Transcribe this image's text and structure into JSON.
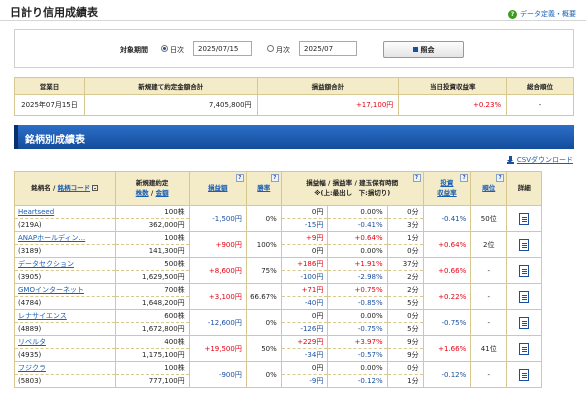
{
  "header": {
    "title": "日計り信用成績表",
    "help_link": "データ定義・概要"
  },
  "filter": {
    "label": "対象期間",
    "daily_label": "日次",
    "daily_value": "2025/07/15",
    "monthly_label": "月次",
    "monthly_value": "2025/07",
    "search_button": "照会"
  },
  "summary": {
    "headers": [
      "営業日",
      "新規建て約定金額合計",
      "損益額合計",
      "当日投資収益率",
      "総合順位"
    ],
    "values": [
      "2025年07月15日",
      "7,405,800円",
      "+17,100円",
      "+0.23%",
      "-"
    ]
  },
  "section": {
    "title": "銘柄別成績表",
    "csv_link": "CSVダウンロード"
  },
  "table": {
    "headers": {
      "name": "銘柄名 /",
      "code": "銘柄コード",
      "contract_line1": "新規建約定",
      "contract_count": "株数",
      "contract_sep": " / ",
      "contract_amount": "金額",
      "profit": "損益額",
      "win_rate": "勝率",
      "range_line1": "損益幅 / 損益率 / 建玉保有時間",
      "range_line2": "※(上:最出し　下:損切り)",
      "yield_line1": "投資",
      "yield_line2": "収益率",
      "rank": "順位",
      "detail": "詳細",
      "q": "?"
    },
    "rows": [
      {
        "name": "Heartseed",
        "code": "(219A)",
        "shares": "100株",
        "amount": "362,000円",
        "profit": "-1,500円",
        "win": "0%",
        "up_amt": "0円",
        "up_pct": "0.00%",
        "up_time": "0分",
        "dn_amt": "-15円",
        "dn_pct": "-0.41%",
        "dn_time": "3分",
        "yield": "-0.41%",
        "rank": "50位"
      },
      {
        "name": "ANAPホールディン...",
        "code": "(3189)",
        "shares": "100株",
        "amount": "141,300円",
        "profit": "+900円",
        "win": "100%",
        "up_amt": "+9円",
        "up_pct": "+0.64%",
        "up_time": "1分",
        "dn_amt": "0円",
        "dn_pct": "0.00%",
        "dn_time": "0分",
        "yield": "+0.64%",
        "rank": "2位"
      },
      {
        "name": "データセクション",
        "code": "(3905)",
        "shares": "500株",
        "amount": "1,629,500円",
        "profit": "+8,600円",
        "win": "75%",
        "up_amt": "+186円",
        "up_pct": "+1.91%",
        "up_time": "37分",
        "dn_amt": "-100円",
        "dn_pct": "-2.98%",
        "dn_time": "2分",
        "yield": "+0.66%",
        "rank": "-"
      },
      {
        "name": "GMOインターネット",
        "code": "(4784)",
        "shares": "700株",
        "amount": "1,648,200円",
        "profit": "+3,100円",
        "win": "66.67%",
        "up_amt": "+71円",
        "up_pct": "+0.75%",
        "up_time": "2分",
        "dn_amt": "-40円",
        "dn_pct": "-0.85%",
        "dn_time": "5分",
        "yield": "+0.22%",
        "rank": "-"
      },
      {
        "name": "レナサイエンス",
        "code": "(4889)",
        "shares": "600株",
        "amount": "1,672,800円",
        "profit": "-12,600円",
        "win": "0%",
        "up_amt": "0円",
        "up_pct": "0.00%",
        "up_time": "0分",
        "dn_amt": "-126円",
        "dn_pct": "-0.75%",
        "dn_time": "5分",
        "yield": "-0.75%",
        "rank": "-"
      },
      {
        "name": "リベルタ",
        "code": "(4935)",
        "shares": "400株",
        "amount": "1,175,100円",
        "profit": "+19,500円",
        "win": "50%",
        "up_amt": "+229円",
        "up_pct": "+3.97%",
        "up_time": "9分",
        "dn_amt": "-34円",
        "dn_pct": "-0.57%",
        "dn_time": "9分",
        "yield": "+1.66%",
        "rank": "41位"
      },
      {
        "name": "フジクラ",
        "code": "(5803)",
        "shares": "100株",
        "amount": "777,100円",
        "profit": "-900円",
        "win": "0%",
        "up_amt": "0円",
        "up_pct": "0.00%",
        "up_time": "0分",
        "dn_amt": "-9円",
        "dn_pct": "-0.12%",
        "dn_time": "1分",
        "yield": "-0.12%",
        "rank": "-"
      }
    ]
  },
  "colors": {
    "positive": "#e60012",
    "negative": "#1a4fa0",
    "header_bg": "#f4ebc8",
    "section_bar": "#1d5db5"
  },
  "icons": [
    "help-icon",
    "radio-icon",
    "search-icon",
    "download-icon",
    "detail-icon",
    "sort-icon",
    "question-icon"
  ]
}
